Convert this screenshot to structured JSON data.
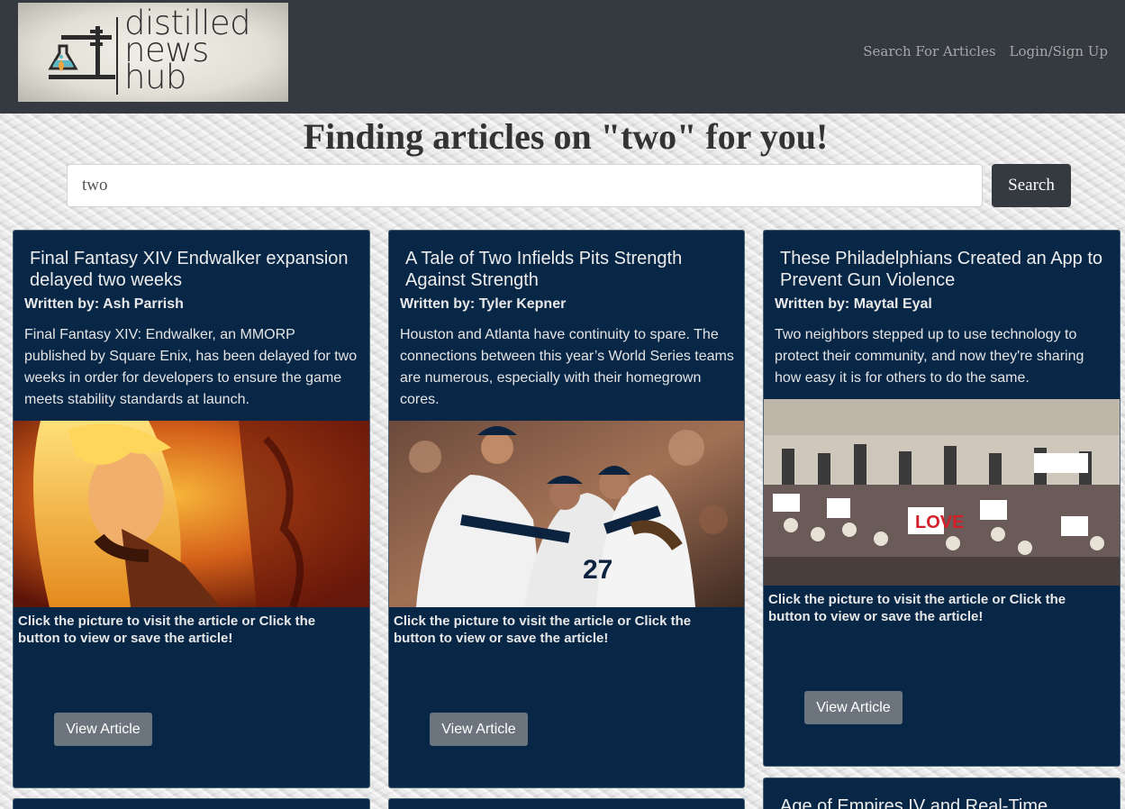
{
  "logo": {
    "line1": "distilled",
    "line2": "news",
    "line3": "hub"
  },
  "nav": {
    "search": "Search For Articles",
    "login": "Login/Sign Up"
  },
  "heading": "Finding articles on \"two\" for you!",
  "search": {
    "value": "two",
    "button": "Search"
  },
  "cards": [
    {
      "title": "Final Fantasy XIV Endwalker expansion delayed two weeks",
      "author": "Written by: Ash Parrish",
      "description": "Final Fantasy XIV: Endwalker, an MMORP published by Square Enix, has been delayed for two weeks in order for developers to ensure the game meets stability standards at launch.",
      "hint": "Click the picture to visit the article or Click the button to view or save the article!",
      "button": "View Article"
    },
    {
      "title": "A Tale of Two Infields Pits Strength Against Strength",
      "author": "Written by: Tyler Kepner",
      "description": "Houston and Atlanta have continuity to spare. The connections between this year’s World Series teams are numerous, especially with their homegrown cores.",
      "hint": "Click the picture to visit the article or Click the button to view or save the article!",
      "button": "View Article"
    },
    {
      "title": "These Philadelphians Created an App to Prevent Gun Violence",
      "author": "Written by: Maytal Eyal",
      "description": "Two neighbors stepped up to use technology to protect their community, and now they're sharing how easy it is for others to do the same.",
      "hint": "Click the picture to visit the article or Click the button to view or save the article!",
      "button": "View Article"
    },
    {
      "title": "Age of Empires IV and Real-Time"
    }
  ]
}
